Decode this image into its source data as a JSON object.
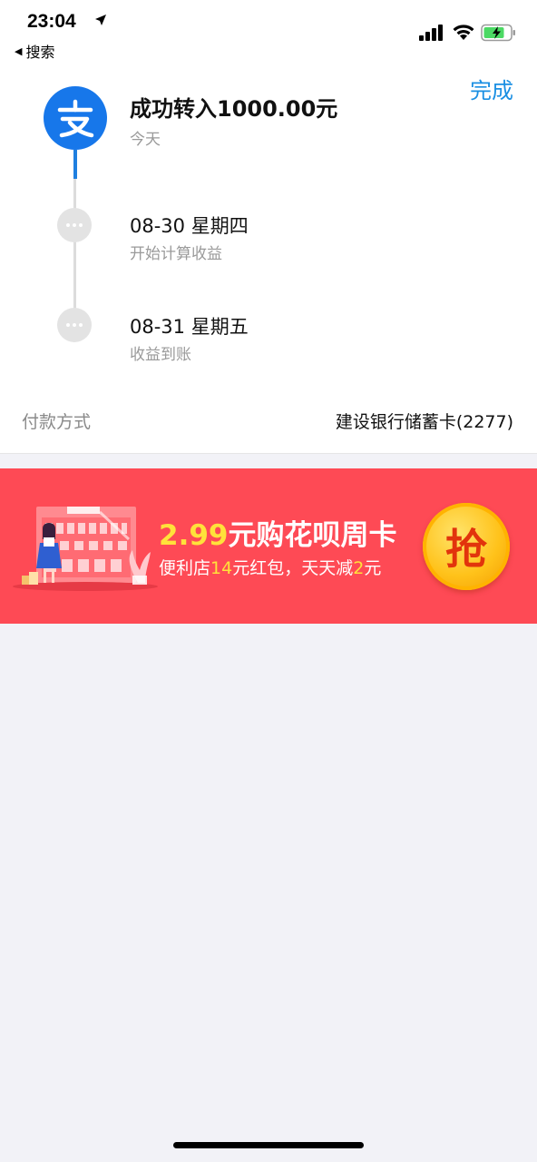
{
  "status_bar": {
    "time": "23:04",
    "back_label": "搜索"
  },
  "header": {
    "done_label": "完成"
  },
  "timeline": {
    "title": "成功转入1000.00元",
    "subtitle": "今天",
    "steps": [
      {
        "date": "08-30 星期四",
        "desc": "开始计算收益"
      },
      {
        "date": "08-31 星期五",
        "desc": "收益到账"
      }
    ]
  },
  "payment": {
    "label": "付款方式",
    "value": "建设银行储蓄卡(2277)"
  },
  "banner": {
    "price": "2.99",
    "main_rest": "元购花呗周卡",
    "sub_1": "便利店",
    "sub_amount_1": "14",
    "sub_2": "元红包，天天减",
    "sub_amount_2": "2",
    "sub_3": "元",
    "button_label": "抢"
  },
  "colors": {
    "accent": "#1a8fe3",
    "alipay_blue": "#1777ea",
    "banner_red": "#fe4a55",
    "highlight_yellow": "#ffe23a"
  }
}
